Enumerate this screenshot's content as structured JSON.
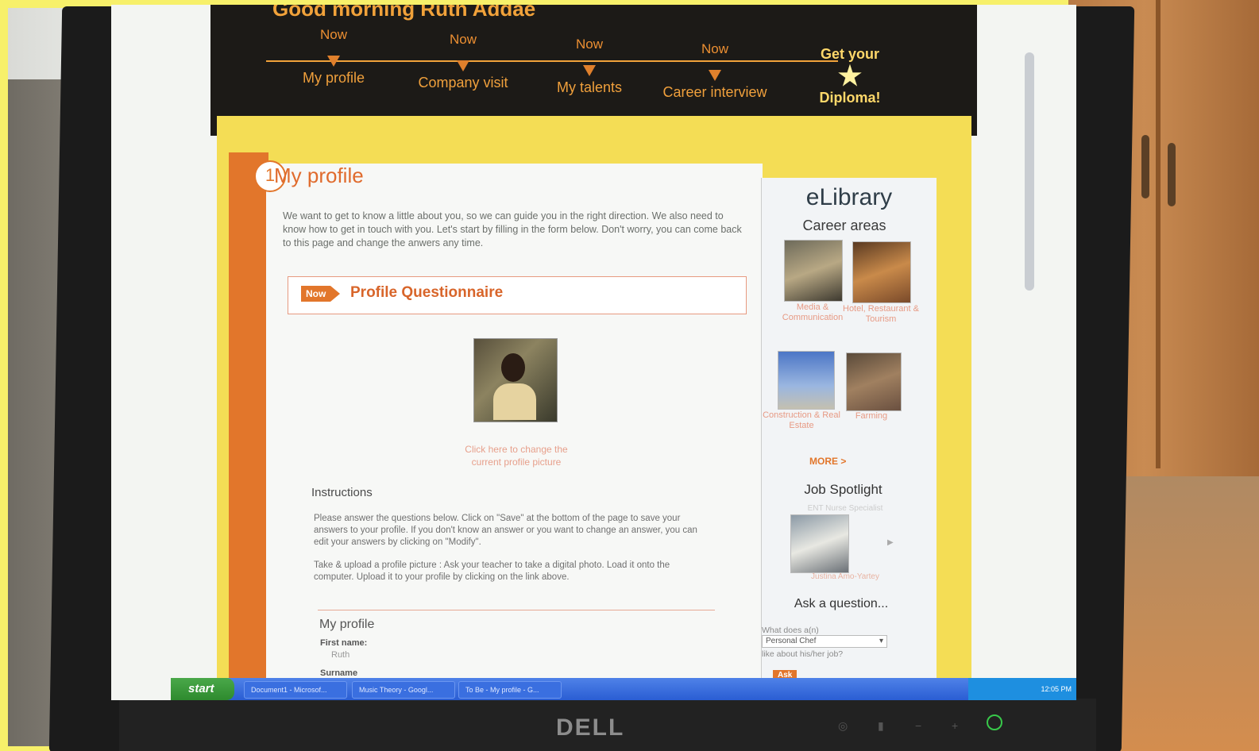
{
  "greeting": "Good morning Ruth Addae",
  "steps": [
    {
      "now": "Now",
      "label": "My profile"
    },
    {
      "now": "Now",
      "label": "Company visit"
    },
    {
      "now": "Now",
      "label": "My talents"
    },
    {
      "now": "Now",
      "label": "Career interview"
    }
  ],
  "final_step": {
    "top": "Get your",
    "bottom": "Diploma!"
  },
  "page": {
    "number": "1",
    "title": "My profile",
    "intro": "We want to get to know a little about you, so we can guide you in the right direction. We also need to know how to get in touch with you. Let's start by filling in the form below. Don't worry, you can come back to this page and change the anwers any time.",
    "badge": "Now",
    "questionnaire_title": "Profile Questionnaire",
    "change_picture": "Click here to change the current profile picture",
    "instructions_heading": "Instructions",
    "instructions_p1": "Please answer the questions below. Click on \"Save\" at the bottom of the page to save your answers to your profile.  If you don't know an answer or you want to change an answer, you can edit your answers by clicking on \"Modify\".",
    "instructions_p2": "Take & upload a profile picture : Ask your teacher to take a digital photo.  Load it onto the computer.  Upload it to your profile by clicking on the link above.",
    "section_heading": "My profile",
    "first_name_label": "First name:",
    "first_name_value": "Ruth",
    "surname_label": "Surname"
  },
  "sidebar": {
    "title": "eLibrary",
    "subtitle": "Career areas",
    "areas": [
      "Media & Communication",
      "Hotel, Restaurant & Tourism",
      "Construction & Real Estate",
      "Farming"
    ],
    "more": "MORE >",
    "spotlight_title": "Job Spotlight",
    "spotlight_job": "ENT Nurse Specialist",
    "spotlight_name": "Justina Amo-Yartey",
    "ask_title": "Ask a question...",
    "ask_prefix": "What does a(n)",
    "ask_selected": "Personal Chef",
    "ask_suffix": "like about his/her job?",
    "ask_button": "Ask"
  },
  "taskbar": {
    "start": "start",
    "tasks": [
      "Document1 - Microsof...",
      "Music Theory - Googl...",
      "To Be - My profile - G..."
    ],
    "clock": "12:05 PM"
  },
  "monitor_brand": "DELL",
  "colors": {
    "accent": "#e2762b",
    "frame": "#f4dd55",
    "header": "#1c1a17"
  }
}
